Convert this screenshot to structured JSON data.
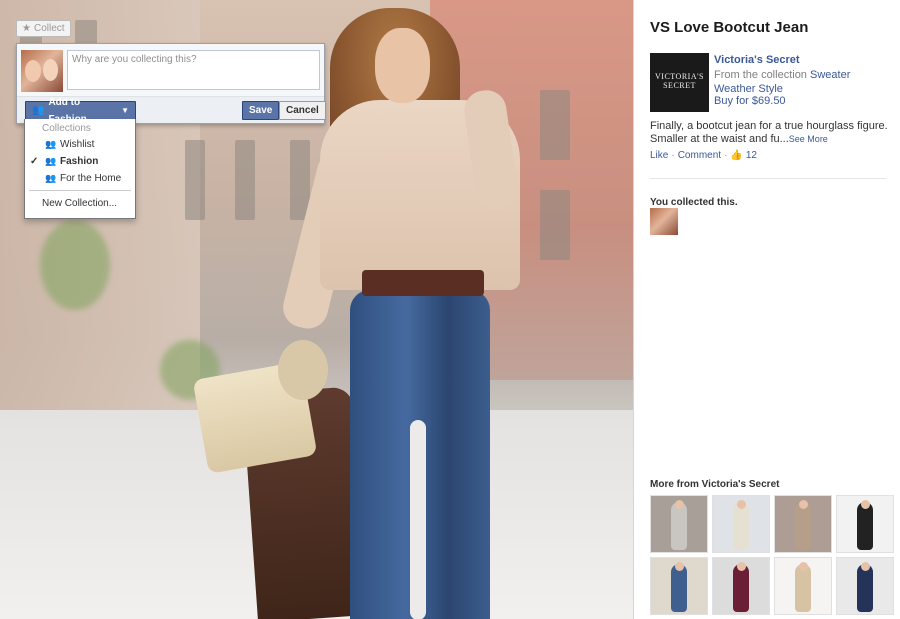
{
  "collect_button": {
    "label": "Collect",
    "icon": "star-icon"
  },
  "popup": {
    "placeholder": "Why are you collecting this?",
    "add_button_label": "Add to Fashion",
    "save_label": "Save",
    "cancel_label": "Cancel"
  },
  "dropdown": {
    "header": "Collections",
    "items": [
      {
        "label": "Wishlist",
        "checked": false
      },
      {
        "label": "Fashion",
        "checked": true
      },
      {
        "label": "For the Home",
        "checked": false
      }
    ],
    "new_collection": "New Collection..."
  },
  "sidebar": {
    "title": "VS Love Bootcut Jean",
    "logo_text": [
      "VICTORIA'S",
      "SECRET"
    ],
    "brand": "Victoria's Secret",
    "from_prefix": "From the collection",
    "collection_name": "Sweater Weather Style",
    "buy": "Buy for $69.50",
    "description": "Finally, a bootcut jean for a true hourglass figure. Smaller at the waist and fu...",
    "see_more": "See More",
    "like": "Like",
    "comment": "Comment",
    "like_count": "12",
    "you_collected": "You collected this.",
    "more_from": "More from Victoria's Secret"
  },
  "colors": {
    "facebook_blue": "#3b5998",
    "button_blue": "#5b74a8"
  },
  "more_thumbs": [
    {
      "bg": "#a89f99",
      "outfit": "#c9c6c2"
    },
    {
      "bg": "#dfe3e8",
      "outfit": "#e6e0d3"
    },
    {
      "bg": "#ad9d95",
      "outfit": "#b69f88"
    },
    {
      "bg": "#f2f2f2",
      "outfit": "#222222"
    },
    {
      "bg": "#dfd8cc",
      "outfit": "#3f5f8f"
    },
    {
      "bg": "#dcdcdc",
      "outfit": "#6a1f35"
    },
    {
      "bg": "#f5f4f2",
      "outfit": "#d7c3a4"
    },
    {
      "bg": "#e9e9ea",
      "outfit": "#25325a"
    }
  ]
}
